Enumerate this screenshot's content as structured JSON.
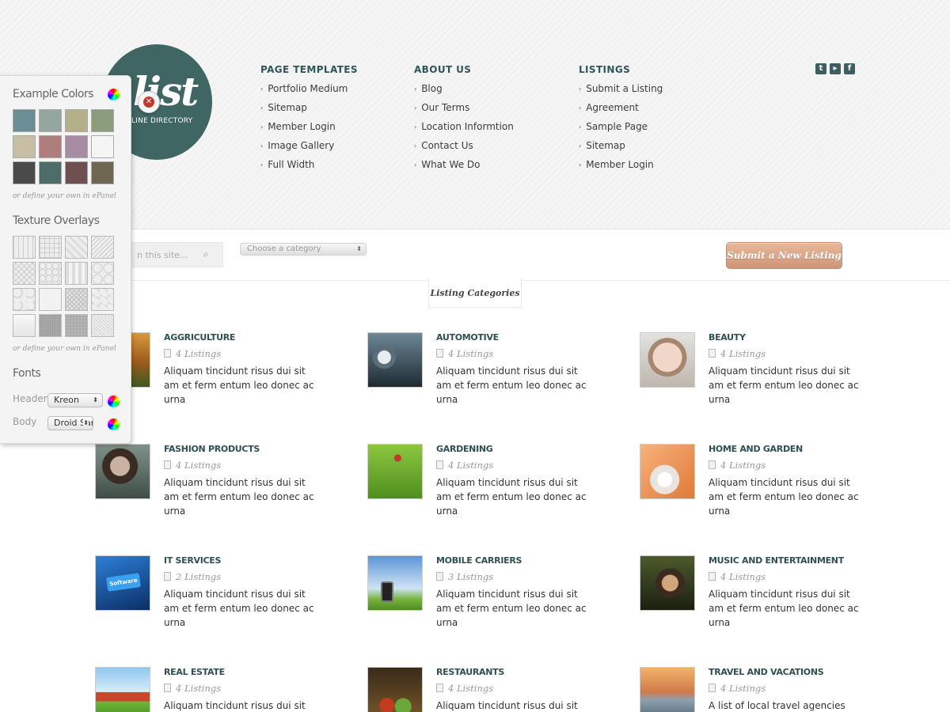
{
  "logo": {
    "word": "list",
    "tagline": "LINE DIRECTORY"
  },
  "nav": [
    {
      "heading": "PAGE TEMPLATES",
      "items": [
        "Portfolio Medium",
        "Sitemap",
        "Member Login",
        "Image Gallery",
        "Full Width"
      ]
    },
    {
      "heading": "ABOUT US",
      "items": [
        "Blog",
        "Our Terms",
        "Location Informtion",
        "Contact Us",
        "What We Do"
      ]
    },
    {
      "heading": "LISTINGS",
      "items": [
        "Submit a Listing",
        "Agreement",
        "Sample Page",
        "Sitemap",
        "Member Login"
      ]
    }
  ],
  "social": {
    "twitter": "t",
    "rss": "▸",
    "facebook": "f"
  },
  "search": {
    "placeholder": "n this site..."
  },
  "category_select": {
    "value": "Choose a category"
  },
  "submit_button": "Submit a New Listing",
  "categories_tab": "Listing Categories",
  "listings": [
    {
      "title": "AGGRICULTURE",
      "count": "4 Listings",
      "desc": "Aliquam tincidunt risus dui sit am et ferm entum leo donec ac urna"
    },
    {
      "title": "AUTOMOTIVE",
      "count": "4 Listings",
      "desc": "Aliquam tincidunt risus dui sit am et ferm entum leo donec ac urna"
    },
    {
      "title": "BEAUTY",
      "count": "4 Listings",
      "desc": "Aliquam tincidunt risus dui sit am et ferm entum leo donec ac urna"
    },
    {
      "title": "FASHION PRODUCTS",
      "count": "4 Listings",
      "desc": "Aliquam tincidunt risus dui sit am et ferm entum leo donec ac urna"
    },
    {
      "title": "GARDENING",
      "count": "4 Listings",
      "desc": "Aliquam tincidunt risus dui sit am et ferm entum leo donec ac urna"
    },
    {
      "title": "HOME AND GARDEN",
      "count": "4 Listings",
      "desc": "Aliquam tincidunt risus dui sit am et ferm entum leo donec ac urna"
    },
    {
      "title": "IT SERVICES",
      "count": "2 Listings",
      "desc": "Aliquam tincidunt risus dui sit am et ferm entum leo donec ac urna",
      "thumb_text": "Software"
    },
    {
      "title": "MOBILE CARRIERS",
      "count": "3 Listings",
      "desc": "Aliquam tincidunt risus dui sit am et ferm entum leo donec ac urna"
    },
    {
      "title": "MUSIC AND ENTERTAINMENT",
      "count": "4 Listings",
      "desc": "Aliquam tincidunt risus dui sit am et ferm entum leo donec ac urna"
    },
    {
      "title": "REAL ESTATE",
      "count": "4 Listings",
      "desc": "Aliquam tincidunt risus dui sit am"
    },
    {
      "title": "RESTAURANTS",
      "count": "4 Listings",
      "desc": "Aliquam tincidunt risus dui sit am"
    },
    {
      "title": "TRAVEL AND VACATIONS",
      "count": "4 Listings",
      "desc": "A list of local travel agencies and"
    }
  ],
  "panel": {
    "colors_heading": "Example Colors",
    "colors_hint": "or define your own in ePanel",
    "swatches": [
      "#6b8d94",
      "#93a79f",
      "#b3b08a",
      "#8c9d7d",
      "#c7bfa3",
      "#b07d7d",
      "#a68ba2",
      "#f5f5f5",
      "#4a4a4a",
      "#4e6d69",
      "#6f4f4f",
      "#6f6752"
    ],
    "texture_heading": "Texture Overlays",
    "texture_hint": "or define your own in ePanel",
    "fonts_heading": "Fonts",
    "header_label": "Header",
    "header_font": "Kreon",
    "body_label": "Body",
    "body_font": "Droid Sans"
  },
  "colors": {
    "brand_teal": "#3f6662",
    "heading_teal": "#2f5558",
    "button_salmon": "#d9a386"
  }
}
